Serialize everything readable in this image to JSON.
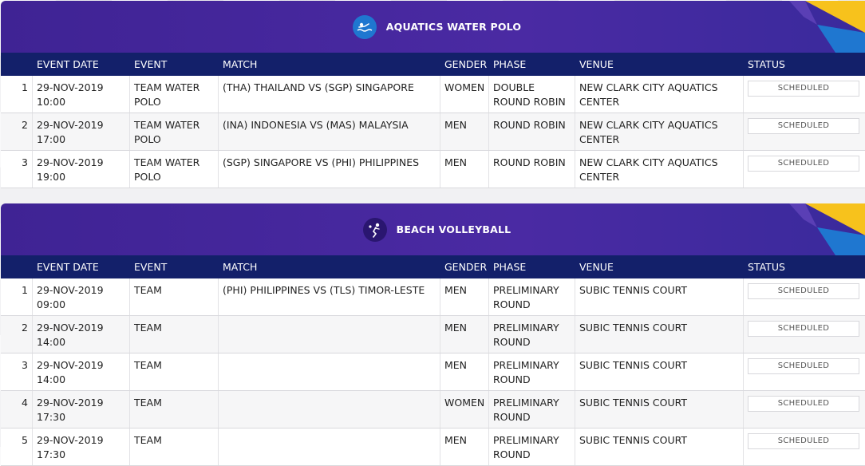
{
  "columns": {
    "event_date": "EVENT DATE",
    "event": "EVENT",
    "match": "MATCH",
    "gender": "GENDER",
    "phase": "PHASE",
    "venue": "VENUE",
    "status": "STATUS"
  },
  "colors": {
    "header_purple": "#4a2aa3",
    "table_header_navy": "#13206a",
    "accent_yellow": "#f7c21c",
    "accent_blue": "#1f77d0"
  },
  "sections": [
    {
      "title": "AQUATICS WATER POLO",
      "icon": "water-polo-icon",
      "rows": [
        {
          "num": "1",
          "date": "29-NOV-2019 10:00",
          "event": "TEAM WATER POLO",
          "match": "(THA) THAILAND VS (SGP) SINGAPORE",
          "gender": "WOMEN",
          "phase": "DOUBLE ROUND ROBIN",
          "venue": "NEW CLARK CITY AQUATICS CENTER",
          "status": "SCHEDULED"
        },
        {
          "num": "2",
          "date": "29-NOV-2019 17:00",
          "event": "TEAM WATER POLO",
          "match": "(INA) INDONESIA VS (MAS) MALAYSIA",
          "gender": "MEN",
          "phase": "ROUND ROBIN",
          "venue": "NEW CLARK CITY AQUATICS CENTER",
          "status": "SCHEDULED"
        },
        {
          "num": "3",
          "date": "29-NOV-2019 19:00",
          "event": "TEAM WATER POLO",
          "match": "(SGP) SINGAPORE VS (PHI) PHILIPPINES",
          "gender": "MEN",
          "phase": "ROUND ROBIN",
          "venue": "NEW CLARK CITY AQUATICS CENTER",
          "status": "SCHEDULED"
        }
      ]
    },
    {
      "title": "BEACH VOLLEYBALL",
      "icon": "beach-volleyball-icon",
      "rows": [
        {
          "num": "1",
          "date": "29-NOV-2019 09:00",
          "event": "TEAM",
          "match": "(PHI) PHILIPPINES VS (TLS) TIMOR-LESTE",
          "gender": "MEN",
          "phase": "PRELIMINARY ROUND",
          "venue": "SUBIC TENNIS COURT",
          "status": "SCHEDULED"
        },
        {
          "num": "2",
          "date": "29-NOV-2019 14:00",
          "event": "TEAM",
          "match": "",
          "gender": "MEN",
          "phase": "PRELIMINARY ROUND",
          "venue": "SUBIC TENNIS COURT",
          "status": "SCHEDULED"
        },
        {
          "num": "3",
          "date": "29-NOV-2019 14:00",
          "event": "TEAM",
          "match": "",
          "gender": "MEN",
          "phase": "PRELIMINARY ROUND",
          "venue": "SUBIC TENNIS COURT",
          "status": "SCHEDULED"
        },
        {
          "num": "4",
          "date": "29-NOV-2019 17:30",
          "event": "TEAM",
          "match": "",
          "gender": "WOMEN",
          "phase": "PRELIMINARY ROUND",
          "venue": "SUBIC TENNIS COURT",
          "status": "SCHEDULED"
        },
        {
          "num": "5",
          "date": "29-NOV-2019 17:30",
          "event": "TEAM",
          "match": "",
          "gender": "MEN",
          "phase": "PRELIMINARY ROUND",
          "venue": "SUBIC TENNIS COURT",
          "status": "SCHEDULED"
        }
      ]
    }
  ]
}
